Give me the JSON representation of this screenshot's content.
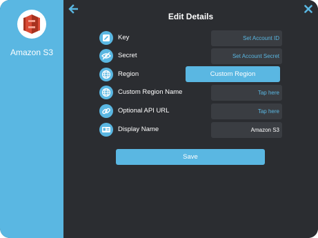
{
  "sidebar": {
    "app_name": "Amazon S3"
  },
  "header": {
    "title": "Edit Details"
  },
  "fields": [
    {
      "label": "Key",
      "value": "Set Account ID"
    },
    {
      "label": "Secret",
      "value": "Set Account Secret"
    },
    {
      "label": "Region",
      "value": "Custom Region"
    },
    {
      "label": "Custom Region Name",
      "value": "Tap here"
    },
    {
      "label": "Optional API URL",
      "value": "Tap here"
    },
    {
      "label": "Display Name",
      "value": "Amazon S3"
    }
  ],
  "save_label": "Save",
  "colors": {
    "accent": "#5ab7e2",
    "background": "#2b2d31",
    "field": "#3a3d42",
    "logo_red": "#d84a35"
  }
}
